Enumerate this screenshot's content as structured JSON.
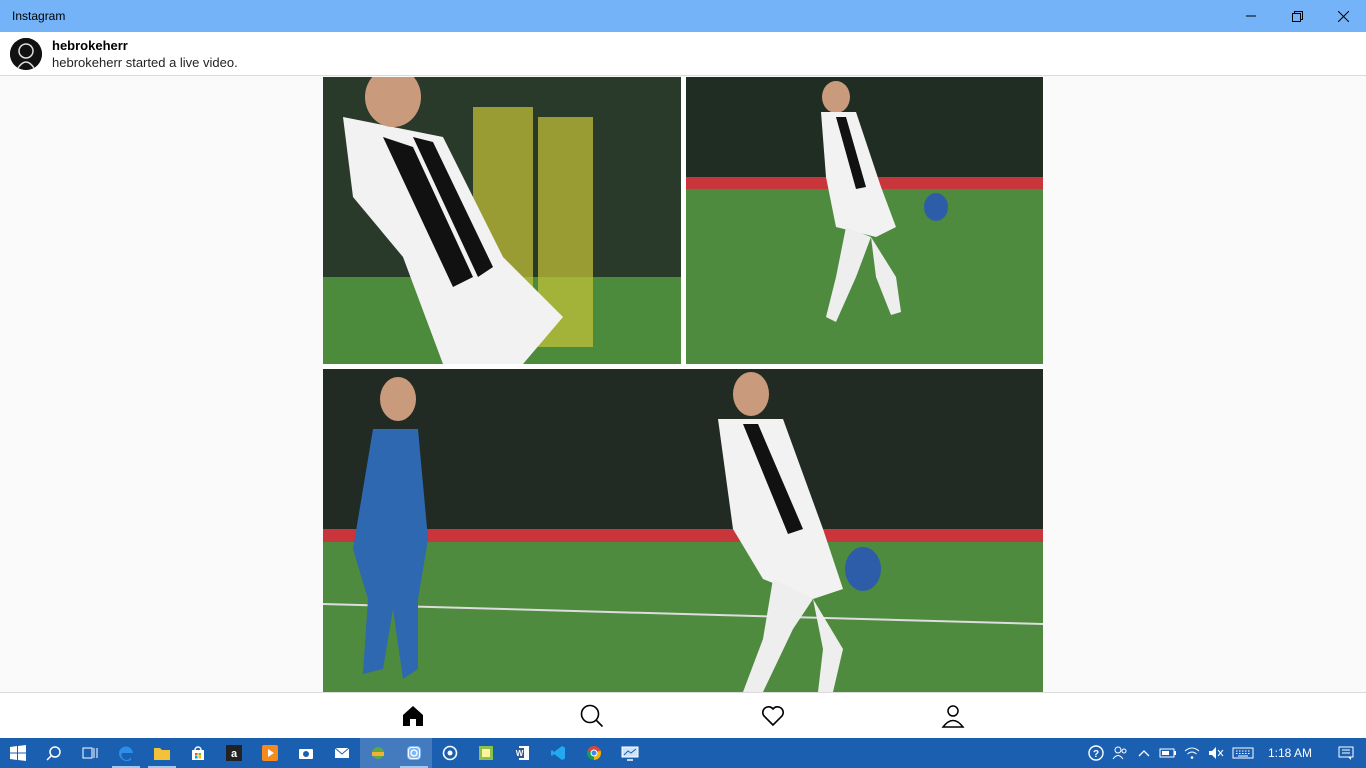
{
  "window": {
    "title": "Instagram"
  },
  "notification": {
    "username": "hebrokeherr",
    "message": "hebrokeherr started a live video."
  },
  "bottom_nav": {
    "items": [
      "home",
      "search",
      "activity",
      "profile"
    ]
  },
  "taskbar": {
    "clock": "1:18 AM"
  },
  "colors": {
    "titlebar": "#74b3f7",
    "taskbar": "#1b5fb0",
    "pitch": "#3f7a35"
  }
}
